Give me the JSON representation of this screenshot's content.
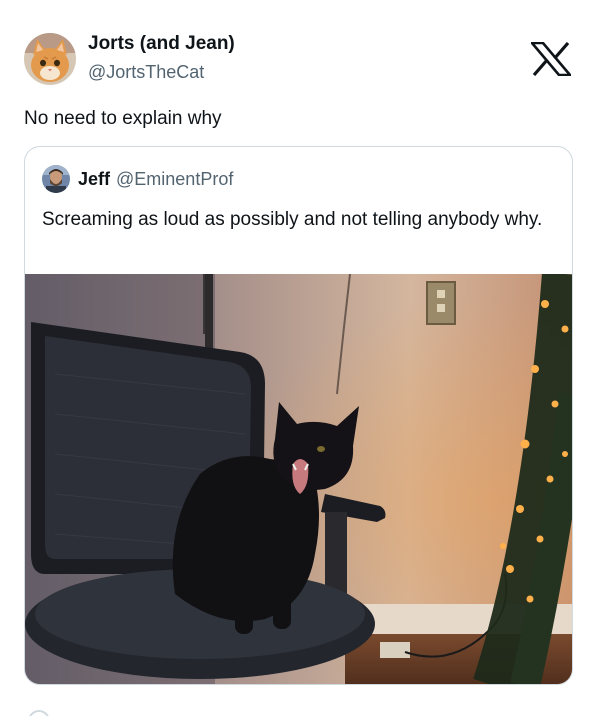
{
  "tweet": {
    "author": {
      "display_name": "Jorts (and Jean)",
      "handle": "@JortsTheCat",
      "avatar_icon": "orange-cat-avatar"
    },
    "text": "No need to explain why",
    "platform_icon": "x-logo-icon"
  },
  "quoted_tweet": {
    "author": {
      "display_name": "Jeff",
      "handle": "@EminentProf",
      "avatar_icon": "person-avatar"
    },
    "text": "Screaming as loud as possibly and not telling anybody why.",
    "media": {
      "icon": "black-cat-screaming-on-office-chair-photo"
    }
  },
  "colors": {
    "text_primary": "#0f1419",
    "text_secondary": "#536471",
    "border": "#cfd9de"
  }
}
